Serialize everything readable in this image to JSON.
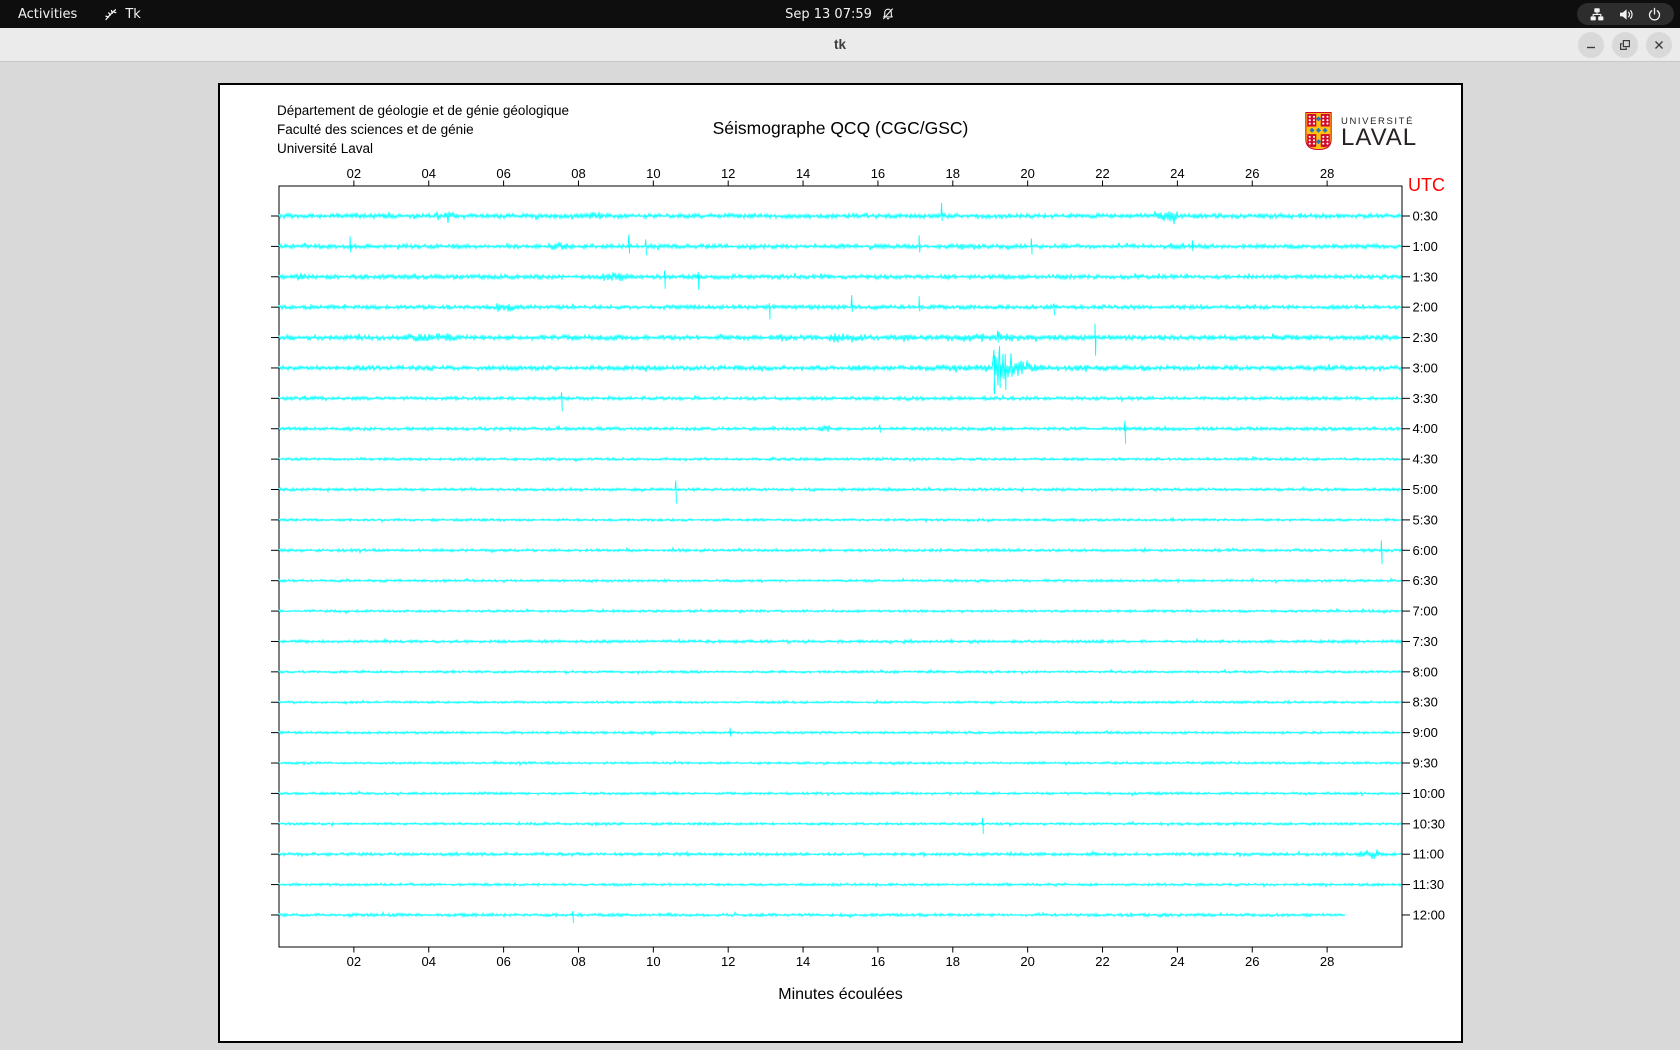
{
  "top_bar": {
    "activities": "Activities",
    "app_name": "Tk",
    "clock": "Sep 13 07:59",
    "icons": {
      "app": "tk-feather-icon",
      "notifications": "bell-slash-icon",
      "network": "network-wired-icon",
      "volume": "speaker-icon",
      "power": "power-icon"
    }
  },
  "window": {
    "title": "tk",
    "controls": {
      "minimize": "minimize",
      "maximize": "maximize",
      "close": "close"
    }
  },
  "canvas": {
    "header_lines": [
      "Département de géologie et de génie géologique",
      "Faculté des sciences et de génie",
      "Université Laval"
    ],
    "title": "Séismographe QCQ (CGC/GSC)",
    "logo": {
      "line1": "UNIVERSITÉ",
      "line2": "LAVAL"
    },
    "utc_label": "UTC",
    "xlabel": "Minutes écoulées"
  },
  "chart_data": {
    "type": "line",
    "title": "Séismographe QCQ (CGC/GSC)",
    "xlabel": "Minutes écoulées",
    "right_axis_label": "UTC",
    "x_range": [
      0,
      30
    ],
    "x_tick_minutes": [
      2,
      4,
      6,
      8,
      10,
      12,
      14,
      16,
      18,
      20,
      22,
      24,
      26,
      28
    ],
    "x_ticks": [
      "02",
      "04",
      "06",
      "08",
      "10",
      "12",
      "14",
      "16",
      "18",
      "20",
      "22",
      "24",
      "26",
      "28"
    ],
    "trace_color": "#00ffff",
    "utc_color": "#ff0000",
    "grid": false,
    "rows": [
      {
        "label": "0:30",
        "amp": 2.6,
        "spikes": [
          {
            "m": 17.7,
            "u": 13,
            "d": 5
          }
        ],
        "blips": [
          [
            4.2,
            4.7,
            4.5
          ],
          [
            8.3,
            8.6,
            4
          ],
          [
            23.4,
            24.0,
            5.5
          ]
        ]
      },
      {
        "label": "1:00",
        "amp": 2.4,
        "spikes": [
          {
            "m": 1.9,
            "u": 10,
            "d": 6
          },
          {
            "m": 9.35,
            "u": 12,
            "d": 7
          },
          {
            "m": 9.8,
            "u": 7,
            "d": 9
          },
          {
            "m": 17.1,
            "u": 11,
            "d": 6
          },
          {
            "m": 20.1,
            "u": 8,
            "d": 8
          },
          {
            "m": 24.4,
            "u": 6,
            "d": 5
          }
        ],
        "blips": [
          [
            7.2,
            7.7,
            4.5
          ]
        ]
      },
      {
        "label": "1:30",
        "amp": 2.4,
        "spikes": [
          {
            "m": 10.3,
            "u": 6,
            "d": 12
          },
          {
            "m": 11.2,
            "u": 5,
            "d": 13
          }
        ],
        "blips": [
          [
            0.3,
            0.7,
            4
          ],
          [
            8.6,
            9.4,
            4.5
          ]
        ]
      },
      {
        "label": "2:00",
        "amp": 2.2,
        "spikes": [
          {
            "m": 13.1,
            "u": 4,
            "d": 12
          },
          {
            "m": 15.3,
            "u": 12,
            "d": 5
          },
          {
            "m": 17.1,
            "u": 11,
            "d": 4
          },
          {
            "m": 20.7,
            "u": 3,
            "d": 8
          }
        ],
        "blips": [
          [
            5.8,
            6.3,
            5
          ]
        ]
      },
      {
        "label": "2:30",
        "amp": 2.8,
        "spikes": [
          {
            "m": 19.2,
            "u": 7,
            "d": 5
          },
          {
            "m": 21.8,
            "u": 14,
            "d": 18
          }
        ],
        "blips": [
          [
            3.1,
            4.8,
            4.5
          ],
          [
            13.3,
            13.6,
            4
          ],
          [
            14.7,
            15.6,
            5
          ],
          [
            17.8,
            19.6,
            4.5
          ]
        ]
      },
      {
        "label": "3:00",
        "amp": 2.6,
        "spikes": [
          {
            "m": 19.1,
            "u": 18,
            "d": 26
          },
          {
            "m": 19.25,
            "u": 22,
            "d": 20
          },
          {
            "m": 19.4,
            "u": 14,
            "d": 22
          }
        ],
        "blips": [
          [
            17.0,
            19.0,
            3.5
          ]
        ],
        "burst": {
          "start": 19.05,
          "peak": 24,
          "decay": 1.5,
          "tail_end": 26,
          "tail_amp": 3.0
        }
      },
      {
        "label": "3:30",
        "amp": 1.9,
        "spikes": [
          {
            "m": 7.55,
            "u": 6,
            "d": 13
          }
        ],
        "blips": []
      },
      {
        "label": "4:00",
        "amp": 1.8,
        "spikes": [
          {
            "m": 16.05,
            "u": 4,
            "d": 4
          },
          {
            "m": 22.6,
            "u": 8,
            "d": 15
          }
        ],
        "blips": [
          [
            14.4,
            14.7,
            3.5
          ]
        ]
      },
      {
        "label": "4:30",
        "amp": 1.5,
        "spikes": [],
        "blips": []
      },
      {
        "label": "5:00",
        "amp": 1.6,
        "spikes": [
          {
            "m": 10.6,
            "u": 9,
            "d": 14
          }
        ],
        "blips": []
      },
      {
        "label": "5:30",
        "amp": 1.4,
        "spikes": [],
        "blips": []
      },
      {
        "label": "6:00",
        "amp": 1.6,
        "spikes": [
          {
            "m": 29.45,
            "u": 10,
            "d": 14
          }
        ],
        "blips": []
      },
      {
        "label": "6:30",
        "amp": 1.4,
        "spikes": [],
        "blips": []
      },
      {
        "label": "7:00",
        "amp": 1.4,
        "spikes": [],
        "blips": []
      },
      {
        "label": "7:30",
        "amp": 1.6,
        "spikes": [],
        "blips": []
      },
      {
        "label": "8:00",
        "amp": 1.4,
        "spikes": [],
        "blips": []
      },
      {
        "label": "8:30",
        "amp": 1.3,
        "spikes": [],
        "blips": []
      },
      {
        "label": "9:00",
        "amp": 1.4,
        "spikes": [
          {
            "m": 12.05,
            "u": 5,
            "d": 4
          }
        ],
        "blips": []
      },
      {
        "label": "9:30",
        "amp": 1.3,
        "spikes": [],
        "blips": []
      },
      {
        "label": "10:00",
        "amp": 1.4,
        "spikes": [],
        "blips": []
      },
      {
        "label": "10:30",
        "amp": 1.4,
        "spikes": [
          {
            "m": 18.8,
            "u": 6,
            "d": 10
          }
        ],
        "blips": []
      },
      {
        "label": "11:00",
        "amp": 1.7,
        "spikes": [],
        "blips": [
          [
            28.8,
            29.4,
            5
          ]
        ]
      },
      {
        "label": "11:30",
        "amp": 1.4,
        "spikes": [],
        "blips": []
      },
      {
        "label": "12:00",
        "amp": 1.7,
        "spikes": [
          {
            "m": 7.85,
            "u": 4,
            "d": 8
          }
        ],
        "blips": [],
        "end": 28.5
      }
    ]
  }
}
